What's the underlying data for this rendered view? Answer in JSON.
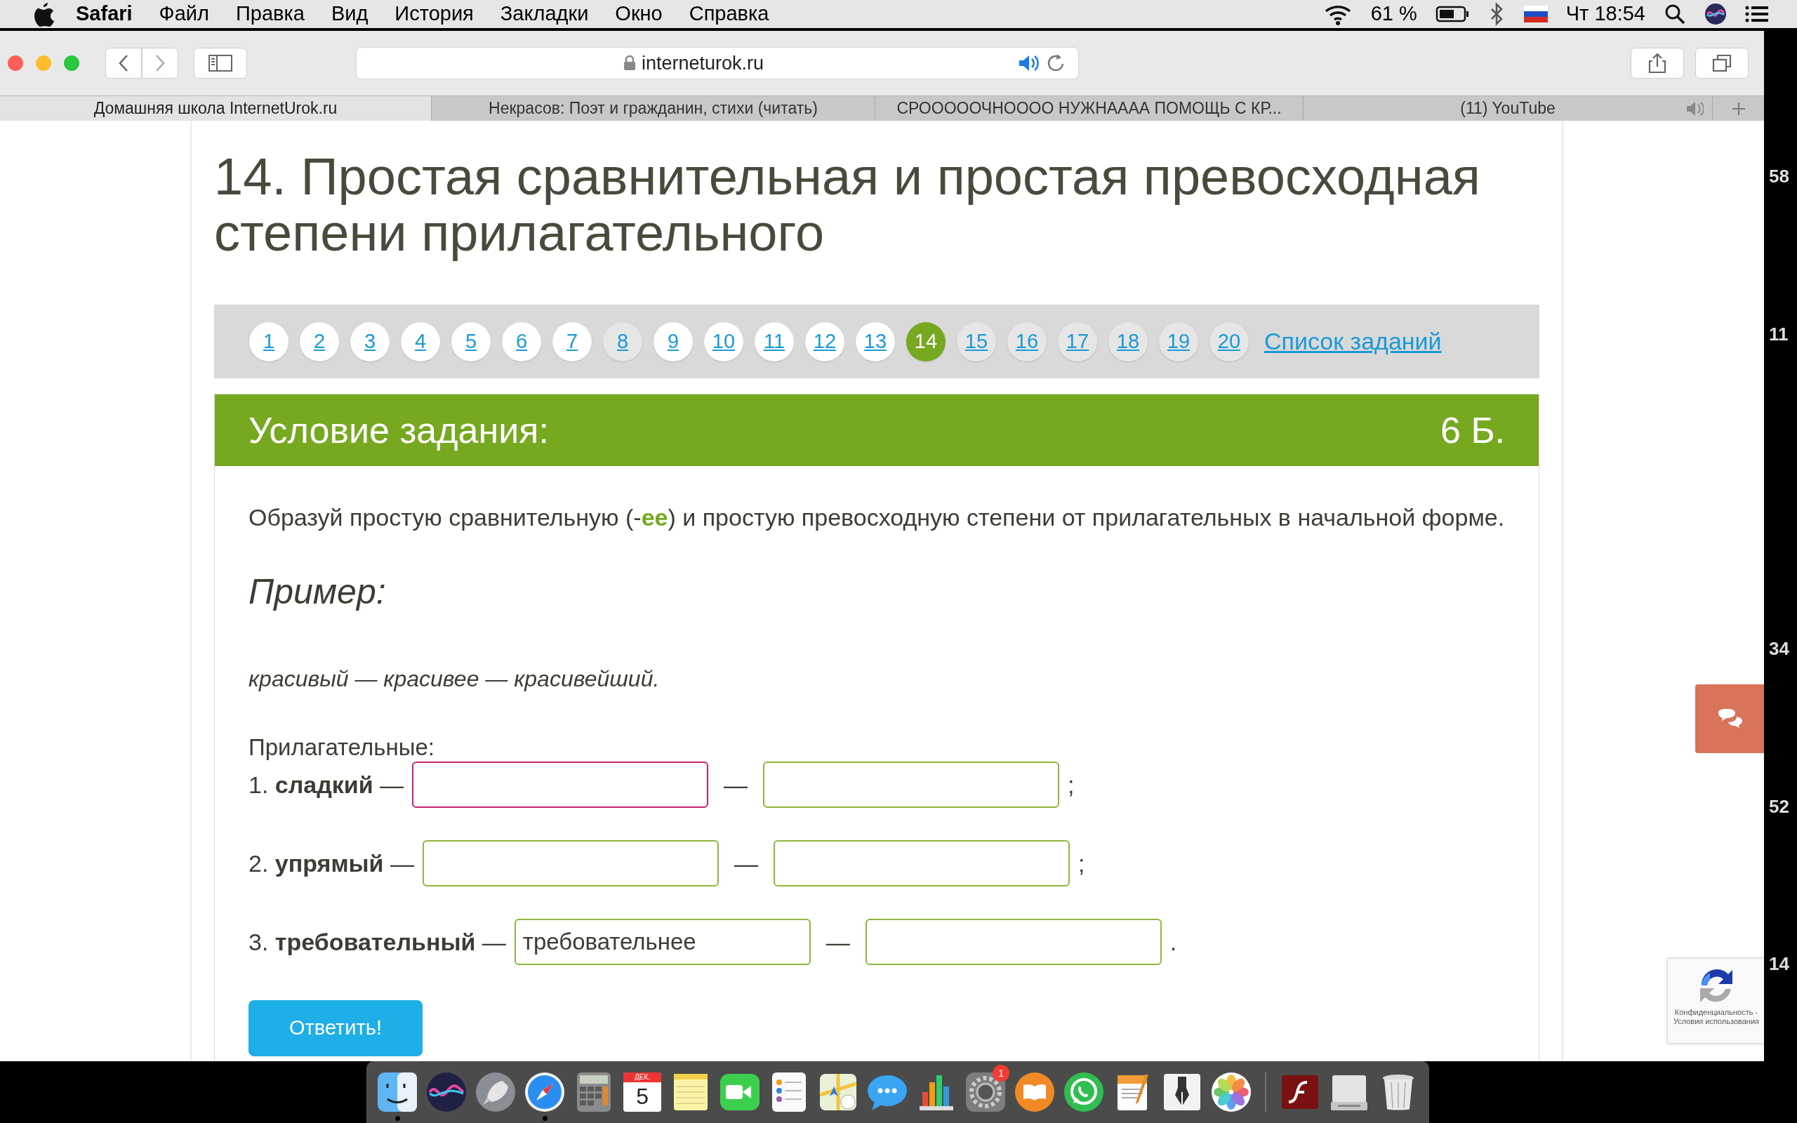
{
  "menu_bar": {
    "app": "Safari",
    "items": [
      "Файл",
      "Правка",
      "Вид",
      "История",
      "Закладки",
      "Окно",
      "Справка"
    ],
    "battery": "61 %",
    "clock": "Чт 18:54"
  },
  "toolbar": {
    "address": "interneturok.ru"
  },
  "tabs": [
    {
      "label": "Домашняя школа InternetUrok.ru",
      "selected": true,
      "audio": false
    },
    {
      "label": "Некрасов: Поэт и гражданин, стихи (читать)",
      "selected": false,
      "audio": false
    },
    {
      "label": "СРОООООЧНОООО НУЖНАААА ПОМОЩЬ С КР...",
      "selected": false,
      "audio": false
    },
    {
      "label": "(11) YouTube",
      "selected": false,
      "audio": true
    }
  ],
  "page": {
    "title": "14. Простая сравнительная и простая превосходная степени прилагательного",
    "pagination": [
      {
        "label": "1",
        "selected": false,
        "shaded": false
      },
      {
        "label": "2",
        "selected": false,
        "shaded": false
      },
      {
        "label": "3",
        "selected": false,
        "shaded": false
      },
      {
        "label": "4",
        "selected": false,
        "shaded": false
      },
      {
        "label": "5",
        "selected": false,
        "shaded": false
      },
      {
        "label": "6",
        "selected": false,
        "shaded": false
      },
      {
        "label": "7",
        "selected": false,
        "shaded": false
      },
      {
        "label": "8",
        "selected": false,
        "shaded": true
      },
      {
        "label": "9",
        "selected": false,
        "shaded": false
      },
      {
        "label": "10",
        "selected": false,
        "shaded": false
      },
      {
        "label": "11",
        "selected": false,
        "shaded": false
      },
      {
        "label": "12",
        "selected": false,
        "shaded": false
      },
      {
        "label": "13",
        "selected": false,
        "shaded": false
      },
      {
        "label": "14",
        "selected": true,
        "shaded": false
      },
      {
        "label": "15",
        "selected": false,
        "shaded": true
      },
      {
        "label": "16",
        "selected": false,
        "shaded": true
      },
      {
        "label": "17",
        "selected": false,
        "shaded": true
      },
      {
        "label": "18",
        "selected": false,
        "shaded": true
      },
      {
        "label": "19",
        "selected": false,
        "shaded": true
      },
      {
        "label": "20",
        "selected": false,
        "shaded": true
      }
    ],
    "task_list_link": "Список заданий",
    "task_header": "Условие задания:",
    "points": "6 Б.",
    "instruction": "Образуй простую сравнительную (-**ее**) и простую превосходную степени от прилагательных в начальной форме.",
    "example_heading": "Пример:",
    "example": "красивый — красивее — красивейший.",
    "adjectives_label": "Прилагательные:",
    "rows": [
      {
        "label": "1. **сладкий** —",
        "dash": "—",
        "end": ";",
        "inputs": [
          {
            "focused": true
          },
          {
            "focused": false
          }
        ]
      },
      {
        "label": "2. **упрямый** —",
        "dash": "—",
        "end": ";",
        "inputs": [
          {
            "focused": false
          },
          {
            "focused": false
          }
        ]
      },
      {
        "label": "3. **требовательный** —",
        "dash": "—",
        "end": ".",
        "inputs": [
          {
            "value": "требовательнее",
            "focused": false
          },
          {
            "focused": false
          }
        ]
      }
    ],
    "submit": "Ответить!"
  },
  "recaptcha": {
    "text": "Конфиденциальность - Условия использования"
  },
  "desktop_numbers": [
    "58",
    "11",
    "34",
    "52",
    "14"
  ],
  "dock": [
    {
      "kind": "finder",
      "running": true
    },
    {
      "kind": "siri",
      "running": false
    },
    {
      "kind": "launchpad",
      "running": false
    },
    {
      "kind": "safari",
      "running": true
    },
    {
      "kind": "calculator",
      "running": false
    },
    {
      "kind": "calendar",
      "running": false,
      "month": "ДЕК.",
      "day": "5"
    },
    {
      "kind": "notes",
      "running": false
    },
    {
      "kind": "facetime",
      "running": false
    },
    {
      "kind": "reminders",
      "running": false
    },
    {
      "kind": "maps",
      "running": false
    },
    {
      "kind": "messages",
      "running": false
    },
    {
      "kind": "numbers",
      "running": false
    },
    {
      "kind": "preferences",
      "running": false,
      "badge": "1"
    },
    {
      "kind": "books",
      "running": false
    },
    {
      "kind": "whatsapp",
      "running": false
    },
    {
      "kind": "pages",
      "running": false
    },
    {
      "kind": "pen",
      "running": false
    },
    {
      "kind": "photos",
      "running": false
    },
    {
      "kind": "separator"
    },
    {
      "kind": "flash",
      "running": false
    },
    {
      "kind": "drive",
      "running": false
    },
    {
      "kind": "trash",
      "running": false
    }
  ]
}
